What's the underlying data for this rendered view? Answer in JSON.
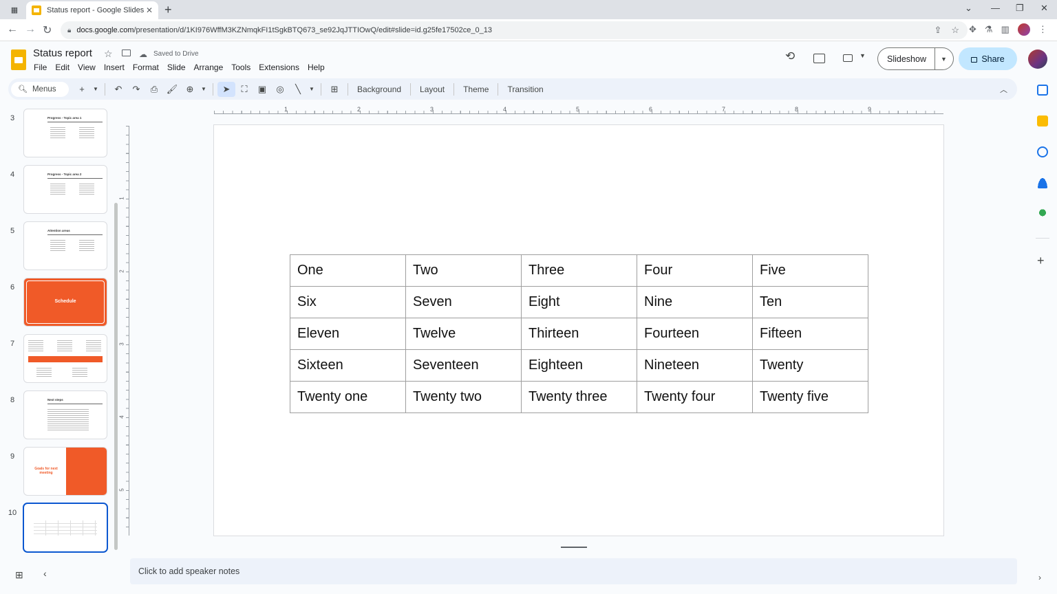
{
  "browser": {
    "tab_title": "Status report - Google Slides",
    "url_host": "docs.google.com",
    "url_path": "/presentation/d/1KI976WffM3KZNmqkFI1tSgkBTQ673_se92JqJTTIOwQ/edit#slide=id.g25fe17502ce_0_13"
  },
  "doc": {
    "title": "Status report",
    "saved_status": "Saved to Drive",
    "menus": [
      "File",
      "Edit",
      "View",
      "Insert",
      "Format",
      "Slide",
      "Arrange",
      "Tools",
      "Extensions",
      "Help"
    ]
  },
  "header": {
    "slideshow_label": "Slideshow",
    "share_label": "Share"
  },
  "toolbar": {
    "search_label": "Menus",
    "text_buttons": [
      "Background",
      "Layout",
      "Theme",
      "Transition"
    ]
  },
  "filmstrip": {
    "slides": [
      {
        "number": "3",
        "title": "Progress - Topic area 1"
      },
      {
        "number": "4",
        "title": "Progress - Topic area 2"
      },
      {
        "number": "5",
        "title": "Attention areas"
      },
      {
        "number": "6",
        "title": "Schedule"
      },
      {
        "number": "7",
        "title": ""
      },
      {
        "number": "8",
        "title": "Next steps"
      },
      {
        "number": "9",
        "title": "Goals for next meeting"
      },
      {
        "number": "10",
        "title": ""
      }
    ],
    "selected": "10"
  },
  "ruler": {
    "horizontal": [
      "1",
      "2",
      "3",
      "4",
      "5",
      "6",
      "7",
      "8",
      "9"
    ],
    "vertical": [
      "1",
      "2",
      "3",
      "4",
      "5"
    ]
  },
  "table": {
    "rows": [
      [
        "One",
        "Two",
        "Three",
        "Four",
        "Five"
      ],
      [
        "Six",
        "Seven",
        "Eight",
        "Nine",
        "Ten"
      ],
      [
        "Eleven",
        "Twelve",
        "Thirteen",
        "Fourteen",
        "Fifteen"
      ],
      [
        "Sixteen",
        "Seventeen",
        "Eighteen",
        "Nineteen",
        "Twenty"
      ],
      [
        "Twenty one",
        "Twenty two",
        "Twenty three",
        "Twenty four",
        "Twenty five"
      ]
    ]
  },
  "notes": {
    "placeholder": "Click to add speaker notes"
  },
  "colors": {
    "accent_orange": "#f05a28",
    "share_bg": "#c2e7ff",
    "selection_blue": "#0b57d0",
    "slides_yellow": "#f4b400"
  }
}
